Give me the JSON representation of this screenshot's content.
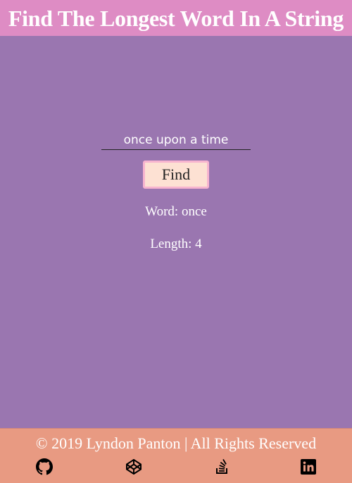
{
  "header": {
    "title": "Find The Longest Word In A String"
  },
  "form": {
    "input_value": "once upon a time",
    "find_label": "Find"
  },
  "results": {
    "word_line": "Word: once",
    "length_line": "Length: 4"
  },
  "footer": {
    "copyright": "© 2019 Lyndon Panton | All Rights Reserved",
    "social_icons": [
      "github-icon",
      "codepen-icon",
      "stack-overflow-icon",
      "linkedin-icon"
    ]
  },
  "colors": {
    "background": "#9a76b0",
    "header": "#de8cc4",
    "footer": "#e89a82",
    "button_bg": "#fde1d3",
    "button_border": "#f7b4cf"
  }
}
